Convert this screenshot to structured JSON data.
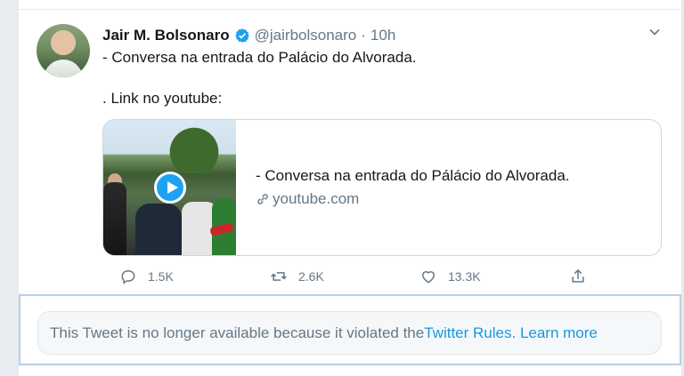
{
  "tweet": {
    "author_name": "Jair M. Bolsonaro",
    "author_handle": "@jairbolsonaro",
    "separator": " · ",
    "time": "10h",
    "lines": [
      "- Conversa na entrada do Palácio do Alvorada.",
      ". Link no youtube:"
    ]
  },
  "card": {
    "title": "- Conversa na entrada do Pálácio do Alvorada.",
    "domain": "youtube.com"
  },
  "actions": {
    "replies": "1.5K",
    "retweets": "2.6K",
    "likes": "13.3K"
  },
  "notice": {
    "text": "This Tweet is no longer available because it violated the ",
    "rules_link": "Twitter Rules.",
    "learn_more": "Learn more"
  },
  "icons": {
    "verified": "verified-badge-icon",
    "caret": "chevron-down-icon",
    "play": "play-icon",
    "link": "link-icon",
    "reply": "reply-icon",
    "retweet": "retweet-icon",
    "like": "heart-icon",
    "share": "share-icon"
  },
  "colors": {
    "accent": "#1da1f2",
    "link": "#1b95e0",
    "muted": "#657786",
    "notice_border": "#b9cfe4"
  }
}
